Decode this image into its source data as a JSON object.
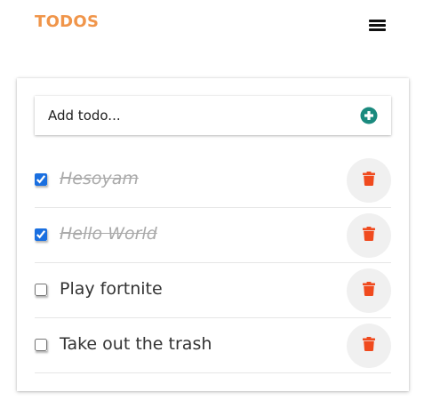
{
  "header": {
    "brand": "TODOS",
    "brand_color": "#f0954a",
    "menu_icon": "hamburger-menu-icon"
  },
  "add_todo": {
    "placeholder": "Add todo...",
    "add_icon": "plus-circle-icon",
    "add_icon_color": "#1a8a7e"
  },
  "todos": [
    {
      "text": "Hesoyam",
      "completed": true
    },
    {
      "text": "Hello World",
      "completed": true
    },
    {
      "text": "Play fortnite",
      "completed": false
    },
    {
      "text": "Take out the trash",
      "completed": false
    }
  ],
  "delete_icon": "trash-icon",
  "delete_icon_color": "#f04a1e"
}
